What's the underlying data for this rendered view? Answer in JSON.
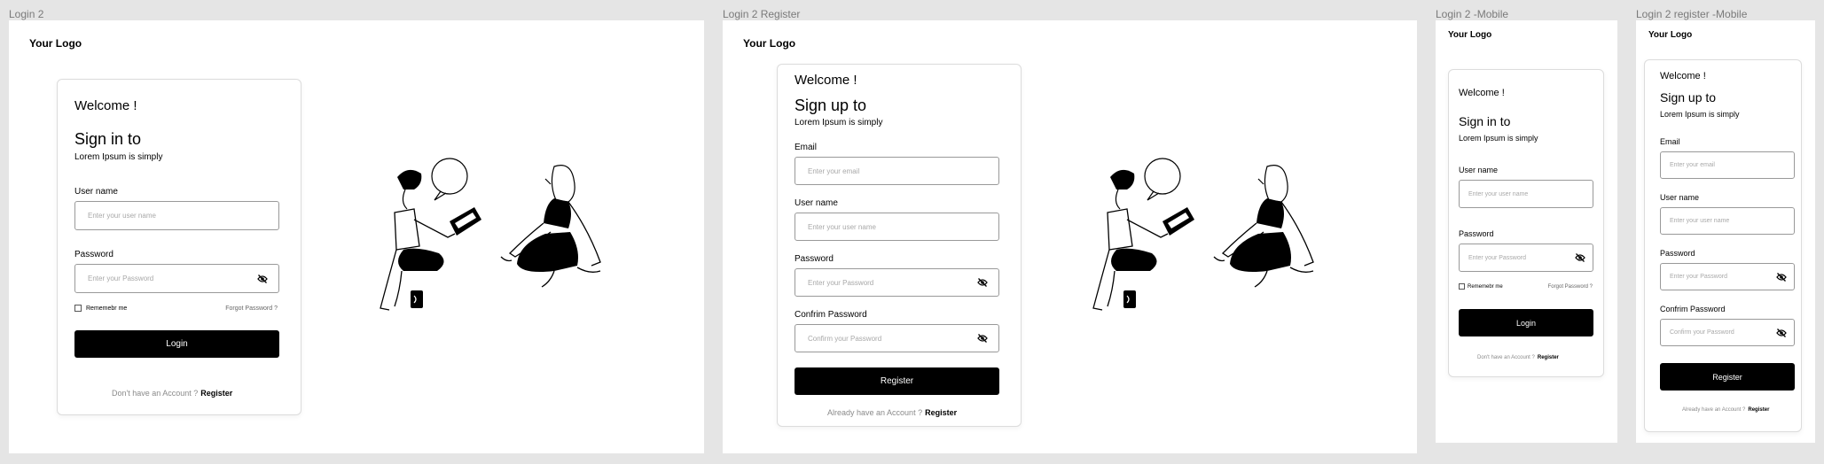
{
  "frames": {
    "login_desktop": {
      "label": "Login 2"
    },
    "register_desktop": {
      "label": "Login 2 Register"
    },
    "login_mobile": {
      "label": "Login 2 -Mobile"
    },
    "register_mobile": {
      "label": "Login 2 register -Mobile"
    }
  },
  "logo": "Your Logo",
  "login": {
    "welcome": "Welcome !",
    "heading": "Sign in to",
    "subtitle": "Lorem Ipsum is simply",
    "username_label": "User name",
    "username_placeholder": "Enter your user name",
    "password_label": "Password",
    "password_placeholder": "Enter your Password",
    "remember": "Rememebr me",
    "forgot": "Forgot Password ?",
    "submit": "Login",
    "footer_text": "Don't have an Account ?",
    "footer_link": "Register"
  },
  "register": {
    "welcome": "Welcome !",
    "heading": "Sign up to",
    "subtitle": "Lorem Ipsum is simply",
    "email_label": "Email",
    "email_placeholder": "Enter your email",
    "username_label": "User name",
    "username_placeholder": "Enter your user name",
    "password_label": "Password",
    "password_placeholder": "Enter your Password",
    "confirm_label": "Confrim Password",
    "confirm_placeholder": "Confirm your Password",
    "submit": "Register",
    "footer_text": "Already have an Account ?",
    "footer_link": "Register"
  },
  "icons": {
    "password_toggle": "eye-off-icon",
    "illustration": "people-chatting-illustration"
  }
}
